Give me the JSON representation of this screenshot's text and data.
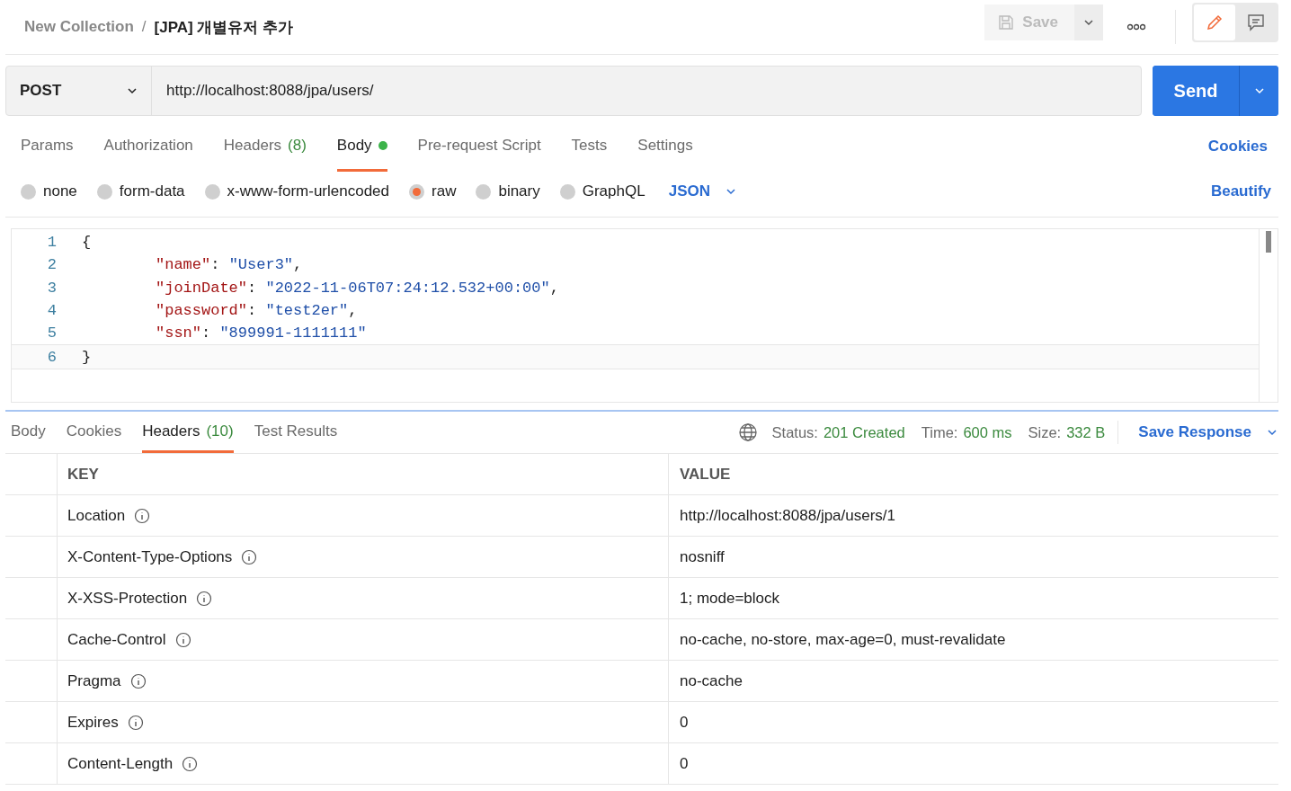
{
  "breadcrumb": {
    "collection": "New Collection",
    "separator": "/",
    "request": "[JPA] 개별유저 추가"
  },
  "toolbar": {
    "save": "Save"
  },
  "request": {
    "method": "POST",
    "url": "http://localhost:8088/jpa/users/",
    "send": "Send"
  },
  "request_tabs": [
    {
      "label": "Params",
      "selected": false
    },
    {
      "label": "Authorization",
      "selected": false
    },
    {
      "label": "Headers",
      "count": "(8)",
      "selected": false
    },
    {
      "label": "Body",
      "indicator": true,
      "selected": true
    },
    {
      "label": "Pre-request Script",
      "selected": false
    },
    {
      "label": "Tests",
      "selected": false
    },
    {
      "label": "Settings",
      "selected": false
    }
  ],
  "cookies_link": "Cookies",
  "body_modes": [
    {
      "label": "none",
      "selected": false
    },
    {
      "label": "form-data",
      "selected": false
    },
    {
      "label": "x-www-form-urlencoded",
      "selected": false
    },
    {
      "label": "raw",
      "selected": true
    },
    {
      "label": "binary",
      "selected": false
    },
    {
      "label": "GraphQL",
      "selected": false
    }
  ],
  "language": "JSON",
  "beautify": "Beautify",
  "editor": {
    "lines": [
      {
        "number": "1",
        "tokens": [
          {
            "kind": "punct",
            "text": "{"
          }
        ]
      },
      {
        "number": "2",
        "tokens": [
          {
            "kind": "indent"
          },
          {
            "kind": "key",
            "text": "\"name\""
          },
          {
            "kind": "punct",
            "text": ": "
          },
          {
            "kind": "string",
            "text": "\"User3\""
          },
          {
            "kind": "punct",
            "text": ","
          }
        ]
      },
      {
        "number": "3",
        "tokens": [
          {
            "kind": "indent"
          },
          {
            "kind": "key",
            "text": "\"joinDate\""
          },
          {
            "kind": "punct",
            "text": ": "
          },
          {
            "kind": "string",
            "text": "\"2022-11-06T07:24:12.532+00:00\""
          },
          {
            "kind": "punct",
            "text": ","
          }
        ]
      },
      {
        "number": "4",
        "tokens": [
          {
            "kind": "indent"
          },
          {
            "kind": "key",
            "text": "\"password\""
          },
          {
            "kind": "punct",
            "text": ": "
          },
          {
            "kind": "string",
            "text": "\"test2er\""
          },
          {
            "kind": "punct",
            "text": ","
          }
        ]
      },
      {
        "number": "5",
        "tokens": [
          {
            "kind": "indent"
          },
          {
            "kind": "key",
            "text": "\"ssn\""
          },
          {
            "kind": "punct",
            "text": ": "
          },
          {
            "kind": "string",
            "text": "\"899991-1111111\""
          }
        ]
      },
      {
        "number": "6",
        "tokens": [
          {
            "kind": "punct",
            "text": "}"
          }
        ]
      }
    ]
  },
  "response_tabs": [
    {
      "label": "Body",
      "selected": false
    },
    {
      "label": "Cookies",
      "selected": false
    },
    {
      "label": "Headers",
      "count": "(10)",
      "selected": true
    },
    {
      "label": "Test Results",
      "selected": false
    }
  ],
  "response_meta": {
    "status_label": "Status:",
    "status": "201 Created",
    "time_label": "Time:",
    "time": "600 ms",
    "size_label": "Size:",
    "size": "332 B",
    "save_response": "Save Response"
  },
  "headers_table": {
    "columns": [
      "KEY",
      "VALUE"
    ],
    "rows": [
      {
        "key": "Location",
        "value": "http://localhost:8088/jpa/users/1"
      },
      {
        "key": "X-Content-Type-Options",
        "value": "nosniff"
      },
      {
        "key": "X-XSS-Protection",
        "value": "1; mode=block"
      },
      {
        "key": "Cache-Control",
        "value": "no-cache, no-store, max-age=0, must-revalidate"
      },
      {
        "key": "Pragma",
        "value": "no-cache"
      },
      {
        "key": "Expires",
        "value": "0"
      },
      {
        "key": "Content-Length",
        "value": "0"
      }
    ]
  }
}
